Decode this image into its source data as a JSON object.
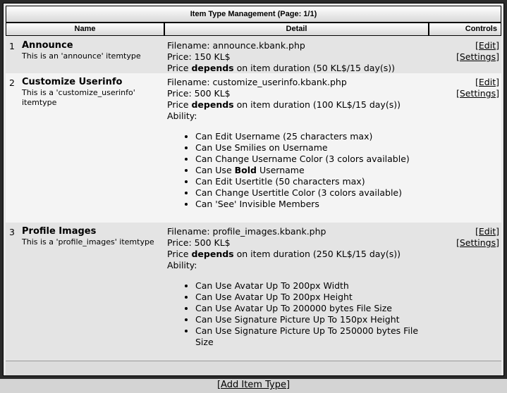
{
  "panel": {
    "title": "Item Type Management (Page: 1/1)",
    "columns": {
      "name": "Name",
      "detail": "Detail",
      "controls": "Controls"
    }
  },
  "items": [
    {
      "num": "1",
      "name": "Announce",
      "description": "This is an 'announce' itemtype",
      "filename": "Filename: announce.kbank.php",
      "price": "Price: 150 KL$",
      "price_mode_pre": "Price ",
      "price_mode_bold": "depends",
      "price_mode_post": " on item duration (50 KL$/15 day(s))",
      "edit": "[Edit]",
      "settings": "[Settings]"
    },
    {
      "num": "2",
      "name": "Customize Userinfo",
      "description": "This is a 'customize_userinfo' itemtype",
      "filename": "Filename: customize_userinfo.kbank.php",
      "price": "Price: 500 KL$",
      "price_mode_pre": "Price ",
      "price_mode_bold": "depends",
      "price_mode_post": " on item duration (100 KL$/15 day(s))",
      "ability_label": "Ability:",
      "abilities": [
        "Can Edit Username (25 characters max)",
        "Can Use Smilies on Username",
        "Can Change Username Color (3 colors available)",
        "Can Use Bold Username",
        "Can Edit Usertitle (50 characters max)",
        "Can Change Usertitle Color (3 colors available)",
        "Can 'See' Invisible Members"
      ],
      "bold_ability_pre": "Can Use ",
      "bold_ability_bold": "Bold",
      "bold_ability_post": " Username",
      "edit": "[Edit]",
      "settings": "[Settings]"
    },
    {
      "num": "3",
      "name": "Profile Images",
      "description": "This is a 'profile_images' itemtype",
      "filename": "Filename: profile_images.kbank.php",
      "price": "Price: 500 KL$",
      "price_mode_pre": "Price ",
      "price_mode_bold": "depends",
      "price_mode_post": " on item duration (250 KL$/15 day(s))",
      "ability_label": "Ability:",
      "abilities": [
        "Can Use Avatar Up To 200px Width",
        "Can Use Avatar Up To 200px Height",
        "Can Use Avatar Up To 200000 bytes File Size",
        "Can Use Signature Picture Up To 150px Height",
        "Can Use Signature Picture Up To 250000 bytes File Size"
      ],
      "edit": "[Edit]",
      "settings": "[Settings]"
    }
  ],
  "footer": {
    "add_link": "[Add Item Type]"
  }
}
